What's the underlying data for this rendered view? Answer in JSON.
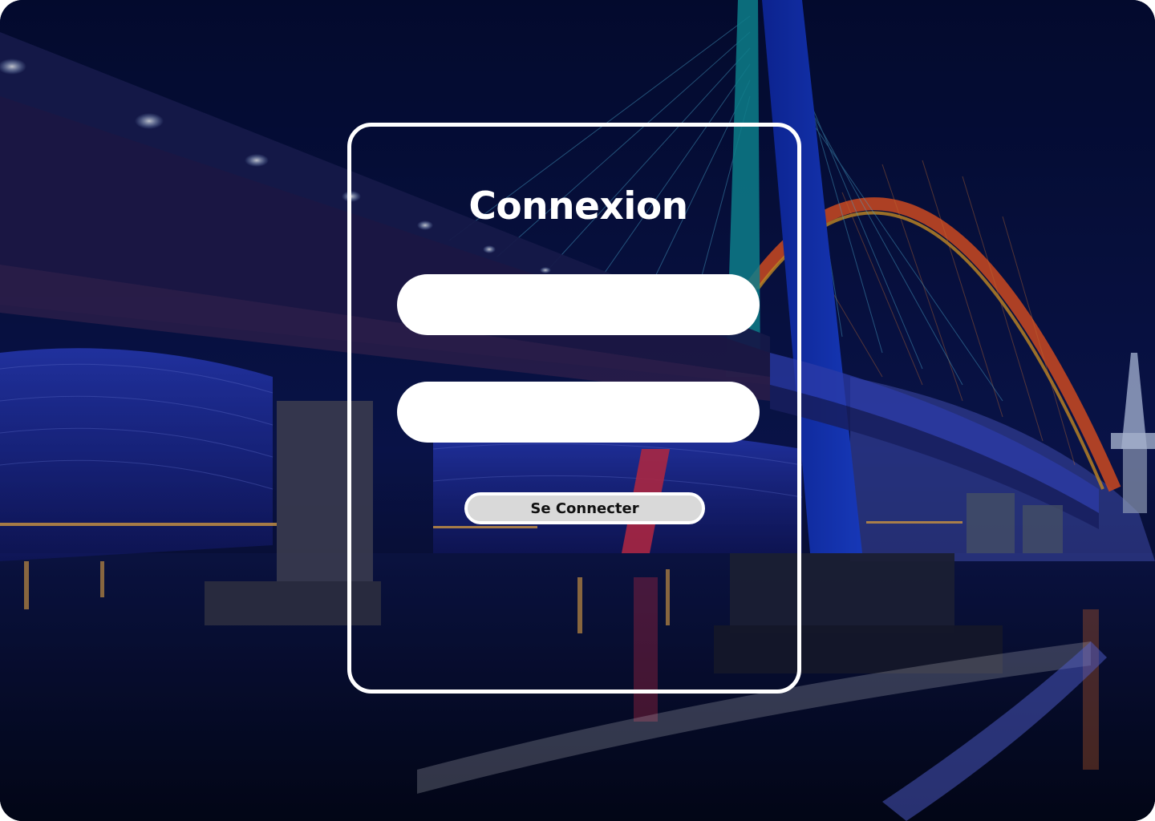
{
  "background": {
    "image": "night-cable-stayed-bridge",
    "overlay_color": "#050b2a"
  },
  "login": {
    "title": "Connexion",
    "username_field": {
      "value": "",
      "placeholder": ""
    },
    "password_field": {
      "value": "",
      "placeholder": ""
    },
    "submit_label": "Se Connecter"
  },
  "colors": {
    "panel_border": "#ffffff",
    "field_background": "#ffffff",
    "button_background": "#d9d9d9",
    "title_text": "#ffffff",
    "button_text": "#111111"
  }
}
